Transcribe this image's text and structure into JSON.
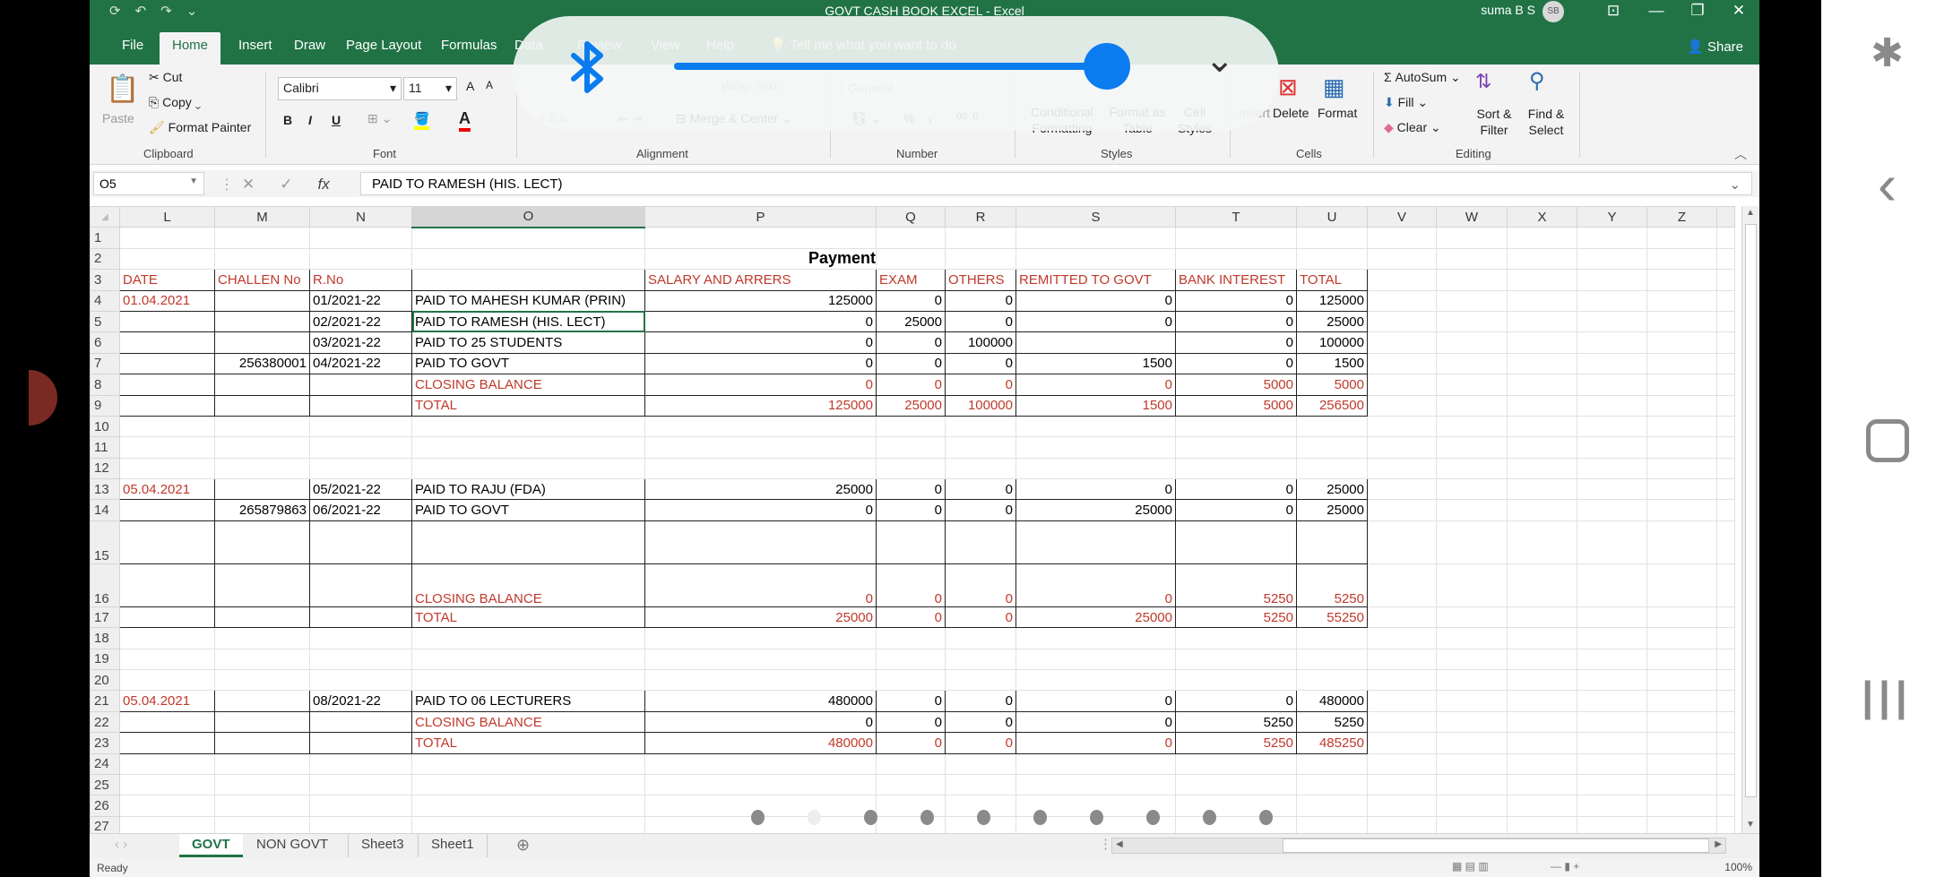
{
  "window": {
    "title": "GOVT CASH BOOK EXCEL  -  Excel",
    "user_name": "suma B S",
    "user_initials": "SB",
    "minimize": "—",
    "restore": "❐",
    "close": "✕",
    "ribbon_display": "⊡"
  },
  "quick_access": {
    "save": "⟳",
    "undo": "↶",
    "redo": "↷",
    "customize": "⌄"
  },
  "tabs": [
    "File",
    "Home",
    "Insert",
    "Draw",
    "Page Layout",
    "Formulas",
    "Data",
    "Review",
    "View",
    "Help"
  ],
  "active_tab": "Home",
  "tell_me": "Tell me what you want to do",
  "share_label": "Share",
  "ribbon": {
    "clipboard": {
      "paste": "Paste",
      "cut": "Cut",
      "copy": "Copy",
      "format_painter": "Format Painter",
      "label": "Clipboard"
    },
    "font": {
      "name": "Calibri",
      "size": "11",
      "bold": "B",
      "italic": "I",
      "underline": "U",
      "grow": "A",
      "shrink": "A",
      "label": "Font"
    },
    "alignment": {
      "wrap_text": "Wrap Text",
      "merge_center": "Merge & Center",
      "label": "Alignment"
    },
    "number": {
      "format": "General",
      "percent": "%",
      "comma": ",",
      "label": "Number"
    },
    "styles": {
      "conditional": "Conditional Formatting",
      "format_table": "Format as Table",
      "cell_styles": "Cell Styles",
      "label": "Styles"
    },
    "cells": {
      "insert": "Insert",
      "delete": "Delete",
      "format": "Format",
      "label": "Cells"
    },
    "editing": {
      "autosum": "AutoSum",
      "fill": "Fill",
      "clear": "Clear",
      "sort_filter": "Sort & Filter",
      "find_select": "Find & Select",
      "label": "Editing"
    }
  },
  "formula_bar": {
    "name_box": "O5",
    "formula": "PAID TO RAMESH (HIS. LECT)",
    "fx": "fx",
    "cancel": "✕",
    "enter": "✓"
  },
  "columns": [
    "L",
    "M",
    "N",
    "O",
    "P",
    "Q",
    "R",
    "S",
    "T",
    "U",
    "V",
    "W",
    "X",
    "Y",
    "Z"
  ],
  "selected_column": "O",
  "sheet": {
    "title": "Payment",
    "headers": [
      "DATE",
      "CHALLEN No",
      "R.No",
      "",
      "SALARY AND ARRERS",
      "EXAM",
      "OTHERS",
      "REMITTED TO GOVT",
      "BANK INTEREST",
      "TOTAL"
    ],
    "rows": [
      {
        "row": 1,
        "cells": []
      },
      {
        "row": 2,
        "cells": []
      },
      {
        "row": 3,
        "cells": []
      },
      {
        "row": 4,
        "cells": [
          "01.04.2021",
          "",
          "01/2021-22",
          "PAID TO MAHESH KUMAR (PRIN)",
          "125000",
          "0",
          "0",
          "0",
          "0",
          "125000"
        ]
      },
      {
        "row": 5,
        "cells": [
          "",
          "",
          "02/2021-22",
          "PAID TO RAMESH (HIS. LECT)",
          "0",
          "25000",
          "0",
          "0",
          "0",
          "25000"
        ]
      },
      {
        "row": 6,
        "cells": [
          "",
          "",
          "03/2021-22",
          "PAID TO 25 STUDENTS",
          "0",
          "0",
          "100000",
          "",
          "0",
          "100000"
        ]
      },
      {
        "row": 7,
        "cells": [
          "",
          "256380001",
          "04/2021-22",
          "PAID TO GOVT",
          "0",
          "0",
          "0",
          "1500",
          "0",
          "1500"
        ]
      },
      {
        "row": 8,
        "cells": [
          "",
          "",
          "",
          "CLOSING BALANCE",
          "0",
          "0",
          "0",
          "0",
          "5000",
          "5000"
        ]
      },
      {
        "row": 9,
        "cells": [
          "",
          "",
          "",
          "TOTAL",
          "125000",
          "25000",
          "100000",
          "1500",
          "5000",
          "256500"
        ]
      },
      {
        "row": 10,
        "cells": []
      },
      {
        "row": 11,
        "cells": []
      },
      {
        "row": 12,
        "cells": []
      },
      {
        "row": 13,
        "cells": [
          "05.04.2021",
          "",
          "05/2021-22",
          "PAID TO RAJU (FDA)",
          "25000",
          "0",
          "0",
          "0",
          "0",
          "25000"
        ]
      },
      {
        "row": 14,
        "cells": [
          "",
          "265879863",
          "06/2021-22",
          "PAID TO GOVT",
          "0",
          "0",
          "0",
          "25000",
          "0",
          "25000"
        ]
      },
      {
        "row": 15,
        "cells": [
          "",
          "",
          "",
          "",
          "",
          "",
          "",
          "",
          "",
          ""
        ]
      },
      {
        "row": 16,
        "cells": [
          "",
          "",
          "",
          "CLOSING BALANCE",
          "0",
          "0",
          "0",
          "0",
          "5250",
          "5250"
        ]
      },
      {
        "row": 17,
        "cells": [
          "",
          "",
          "",
          "TOTAL",
          "25000",
          "0",
          "0",
          "25000",
          "5250",
          "55250"
        ]
      },
      {
        "row": 18,
        "cells": []
      },
      {
        "row": 19,
        "cells": []
      },
      {
        "row": 20,
        "cells": []
      },
      {
        "row": 21,
        "cells": [
          "05.04.2021",
          "",
          "08/2021-22",
          "PAID TO 06 LECTURERS",
          "480000",
          "0",
          "0",
          "0",
          "0",
          "480000"
        ]
      },
      {
        "row": 22,
        "cells": [
          "",
          "",
          "",
          "CLOSING BALANCE",
          "0",
          "0",
          "0",
          "0",
          "5250",
          "5250"
        ]
      },
      {
        "row": 23,
        "cells": [
          "",
          "",
          "",
          "TOTAL",
          "480000",
          "0",
          "0",
          "0",
          "5250",
          "485250"
        ]
      },
      {
        "row": 24,
        "cells": []
      },
      {
        "row": 25,
        "cells": []
      },
      {
        "row": 26,
        "cells": []
      },
      {
        "row": 27,
        "cells": []
      }
    ]
  },
  "sheet_tabs": [
    "GOVT",
    "NON GOVT",
    "Sheet3",
    "Sheet1"
  ],
  "active_sheet": "GOVT",
  "add_sheet": "+",
  "status": {
    "text": "Ready",
    "zoom": "100%"
  },
  "overlay": {
    "bluetooth_icon": "bluetooth",
    "volume_level": 0.95,
    "page_dots": 10,
    "active_dot": 2,
    "expand": "⌄"
  },
  "android_nav": {
    "accessibility": "accessibility",
    "back": "‹",
    "home": "▢",
    "recents": "|||"
  },
  "colors": {
    "excel_green": "#217346",
    "header_red": "#c0392b",
    "bluetooth_blue": "#0a7cf0"
  }
}
